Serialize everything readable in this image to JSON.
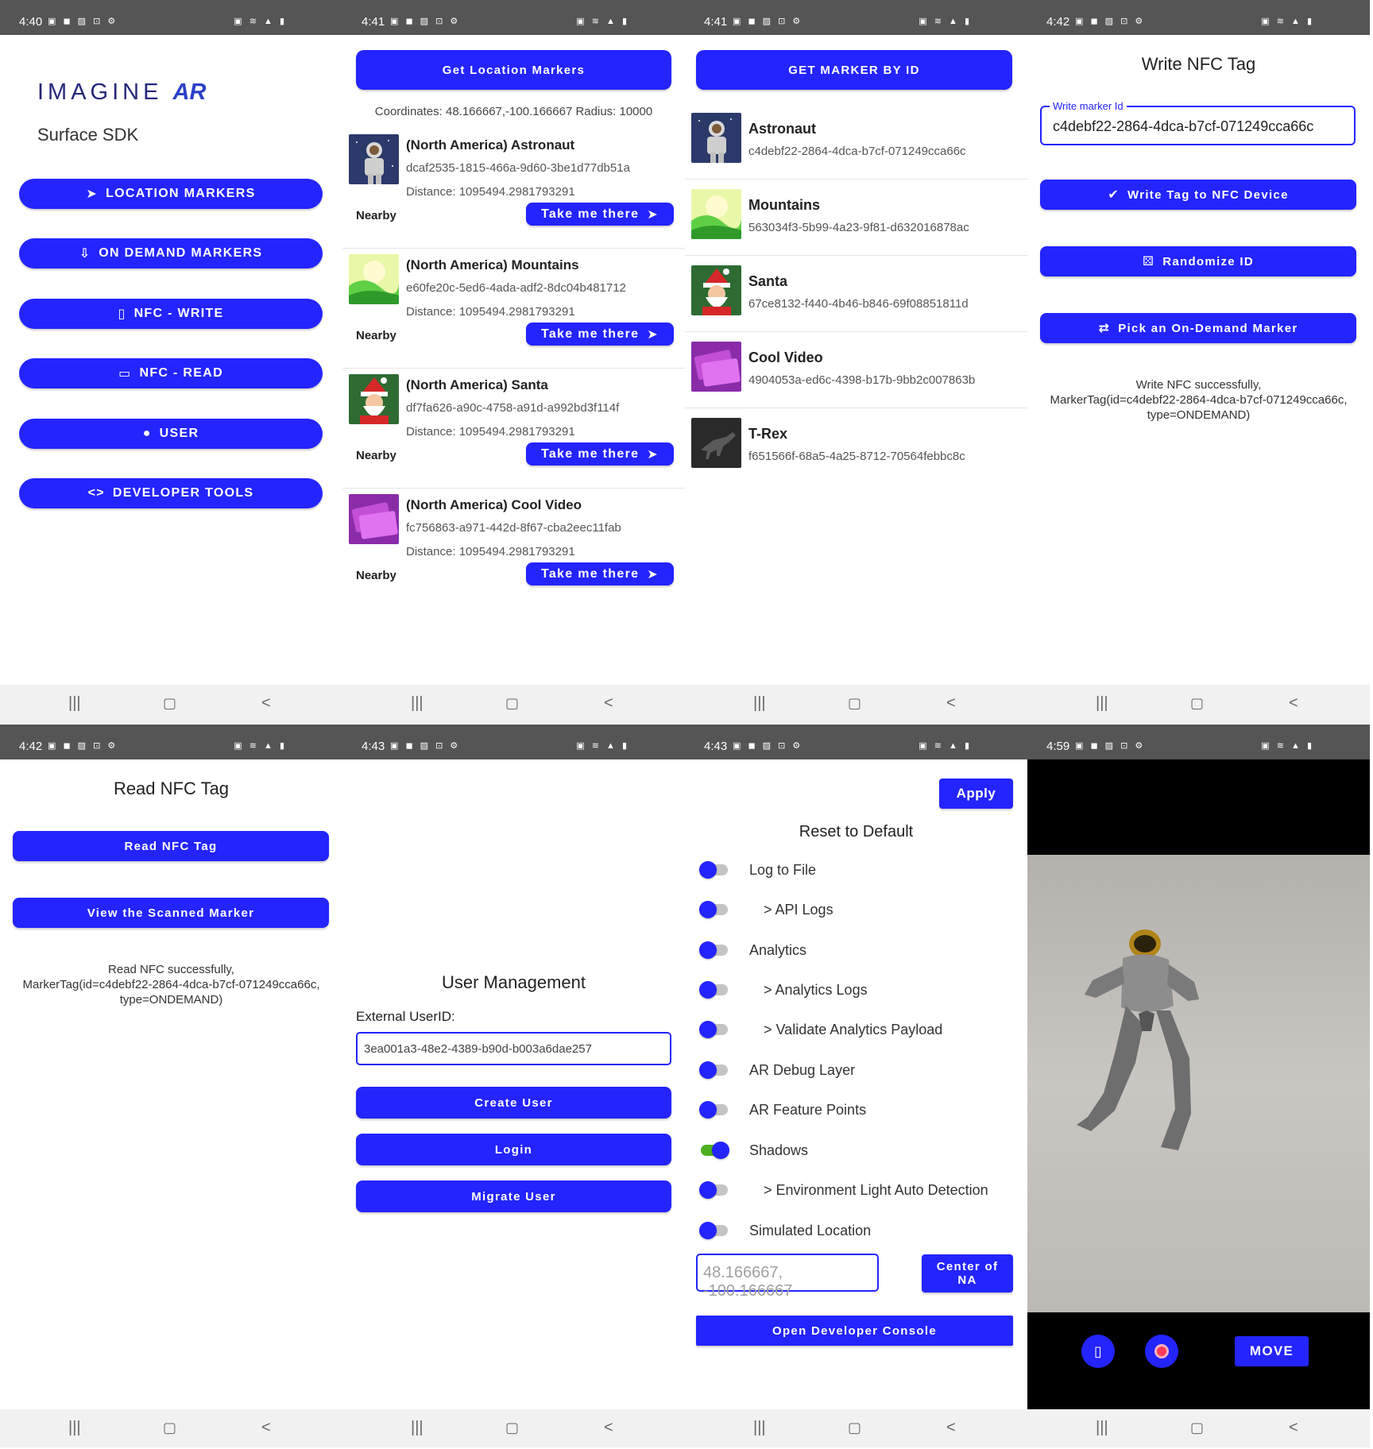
{
  "status_times": [
    "4:40",
    "4:41",
    "4:41",
    "4:42",
    "4:42",
    "4:43",
    "4:43",
    "4:59"
  ],
  "status_icons_left": "▣ ◼ ▨ ⊡ ⚙",
  "status_icons_right": "▣ ≋ ▲ ▮",
  "nav": {
    "recents": "|||",
    "home": "▢",
    "back": "<"
  },
  "home": {
    "logo_text": "IMAGINE",
    "logo_ar": "AR",
    "subtitle": "Surface SDK",
    "buttons": [
      {
        "icon": "➤",
        "label": "LOCATION MARKERS"
      },
      {
        "icon": "⇩",
        "label": "ON DEMAND MARKERS"
      },
      {
        "icon": "▯",
        "label": "NFC - WRITE"
      },
      {
        "icon": "▭",
        "label": "NFC - READ"
      },
      {
        "icon": "●",
        "label": "USER"
      },
      {
        "icon": "<>",
        "label": "DEVELOPER TOOLS"
      }
    ]
  },
  "location": {
    "button": "Get Location Markers",
    "coordinates": "Coordinates: 48.166667,-100.166667 Radius: 10000",
    "items": [
      {
        "name": "(North America) Astronaut",
        "id": "dcaf2535-1815-466a-9d60-3be1d77db51a",
        "distance": "Distance: 1095494.2981793291",
        "nearby": "Nearby",
        "action": "Take me there"
      },
      {
        "name": "(North America) Mountains",
        "id": "e60fe20c-5ed6-4ada-adf2-8dc04b481712",
        "distance": "Distance: 1095494.2981793291",
        "nearby": "Nearby",
        "action": "Take me there"
      },
      {
        "name": "(North America) Santa",
        "id": "df7fa626-a90c-4758-a91d-a992bd3f114f",
        "distance": "Distance: 1095494.2981793291",
        "nearby": "Nearby",
        "action": "Take me there"
      },
      {
        "name": "(North America) Cool Video",
        "id": "fc756863-a971-442d-8f67-cba2eec11fab",
        "distance": "Distance: 1095494.2981793291",
        "nearby": "Nearby",
        "action": "Take me there"
      }
    ]
  },
  "ondemand": {
    "button": "GET MARKER BY ID",
    "items": [
      {
        "name": "Astronaut",
        "id": "c4debf22-2864-4dca-b7cf-071249cca66c"
      },
      {
        "name": "Mountains",
        "id": "563034f3-5b99-4a23-9f81-d632016878ac"
      },
      {
        "name": "Santa",
        "id": "67ce8132-f440-4b46-b846-69f08851811d"
      },
      {
        "name": "Cool Video",
        "id": "4904053a-ed6c-4398-b17b-9bb2c007863b"
      },
      {
        "name": "T-Rex",
        "id": "f651566f-68a5-4a25-8712-70564febbc8c"
      }
    ]
  },
  "nfc_write": {
    "title": "Write NFC Tag",
    "field_label": "Write marker Id",
    "field_value": "c4debf22-2864-4dca-b7cf-071249cca66c",
    "write_button": "Write Tag to NFC Device",
    "randomize_button": "Randomize ID",
    "pick_button": "Pick an On-Demand Marker",
    "message_line1": "Write NFC successfully,",
    "message_line2": "MarkerTag(id=c4debf22-2864-4dca-b7cf-071249cca66c,",
    "message_line3": "type=ONDEMAND)"
  },
  "nfc_read": {
    "title": "Read NFC Tag",
    "read_button": "Read NFC Tag",
    "view_button": "View the Scanned Marker",
    "message_line1": "Read NFC successfully,",
    "message_line2": "MarkerTag(id=c4debf22-2864-4dca-b7cf-071249cca66c,",
    "message_line3": "type=ONDEMAND)"
  },
  "user": {
    "title": "User Management",
    "label": "External UserID:",
    "user_id": "3ea001a3-48e2-4389-b90d-b003a6dae257",
    "create": "Create User",
    "login": "Login",
    "migrate": "Migrate User"
  },
  "dev": {
    "apply": "Apply",
    "reset": "Reset to Default",
    "options": [
      {
        "label": "Log to File",
        "on": false,
        "indent": false
      },
      {
        "label": "> API Logs",
        "on": false,
        "indent": true
      },
      {
        "label": "Analytics",
        "on": false,
        "indent": false
      },
      {
        "label": "> Analytics Logs",
        "on": false,
        "indent": true
      },
      {
        "label": "> Validate Analytics Payload",
        "on": false,
        "indent": true
      },
      {
        "label": "AR Debug Layer",
        "on": false,
        "indent": false
      },
      {
        "label": "AR Feature Points",
        "on": false,
        "indent": false
      },
      {
        "label": "Shadows",
        "on": true,
        "indent": false
      },
      {
        "label": "> Environment Light Auto Detection",
        "on": false,
        "indent": true
      },
      {
        "label": "Simulated Location",
        "on": false,
        "indent": false
      }
    ],
    "location_placeholder": "48.166667, -100.166667",
    "center_button_line1": "Center of",
    "center_button_line2": "NA",
    "console_button": "Open Developer Console"
  },
  "ar": {
    "move_button": "MOVE"
  }
}
